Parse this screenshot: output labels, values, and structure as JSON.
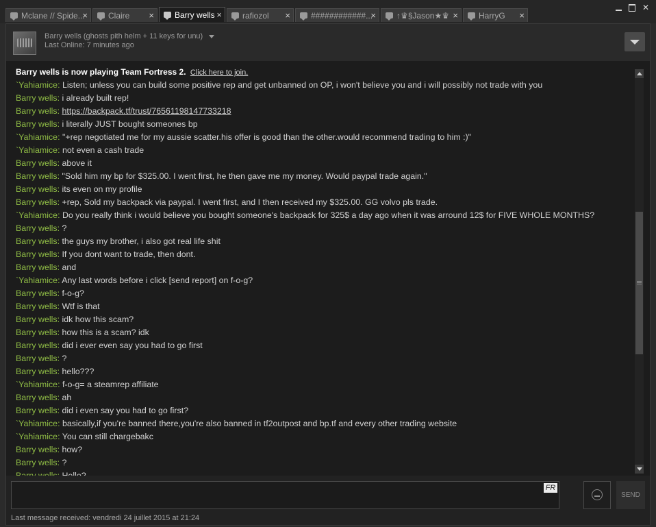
{
  "tabs": [
    {
      "label": "Mclane // Spide...",
      "close": "×",
      "active": false
    },
    {
      "label": "Claire",
      "close": "×",
      "active": false
    },
    {
      "label": "Barry wells",
      "close": "×",
      "active": true
    },
    {
      "label": "rafiozol",
      "close": "×",
      "active": false
    },
    {
      "label": "############...",
      "close": "×",
      "active": false
    },
    {
      "label": "↑♛§Jason★♛",
      "close": "×",
      "active": false
    },
    {
      "label": "HarryG",
      "close": "×",
      "active": false
    }
  ],
  "window": {
    "close_glyph": "✕"
  },
  "header": {
    "friend_name": "Barry wells",
    "friend_nick": "(ghosts pith helm + 11 keys for unu)",
    "last_online": "Last Online: 7 minutes ago"
  },
  "chat": {
    "clipped_top": "· · · ·",
    "system_message": "Barry wells is now playing Team Fortress 2.",
    "join_link": "Click here to join.",
    "messages": [
      {
        "sender": "`Yahiamice",
        "text": "Listen; unless you can build some positive rep and get unbanned on OP, i won't believe you and i will possibly not trade with you"
      },
      {
        "sender": "Barry wells",
        "text": "i already built rep!"
      },
      {
        "sender": "Barry wells",
        "text": "https://backpack.tf/trust/76561198147733218",
        "link": true
      },
      {
        "sender": "Barry wells",
        "text": "i literally JUST bought someones bp"
      },
      {
        "sender": "`Yahiamice",
        "text": "\"+rep negotiated me for my aussie scatter.his offer is good than the other.would recommend trading to him :)\""
      },
      {
        "sender": "`Yahiamice",
        "text": "not even a cash trade"
      },
      {
        "sender": "Barry wells",
        "text": "above it"
      },
      {
        "sender": "Barry wells",
        "text": "\"Sold him my bp for $325.00. I went first, he then gave me my money. Would paypal trade again.\""
      },
      {
        "sender": "Barry wells",
        "text": "its even on my profile"
      },
      {
        "sender": "Barry wells",
        "text": "+rep, Sold my backpack via paypal. I went first, and I then received my $325.00. GG volvo pls trade."
      },
      {
        "sender": "`Yahiamice",
        "text": "Do you really think i would believe you bought someone's backpack for 325$ a day ago when it was arround 12$ for FIVE WHOLE MONTHS?"
      },
      {
        "sender": "Barry wells",
        "text": "?"
      },
      {
        "sender": "Barry wells",
        "text": "the guys my brother, i also got real life shit"
      },
      {
        "sender": "Barry wells",
        "text": "If you dont want to trade, then dont."
      },
      {
        "sender": "Barry wells",
        "text": "and"
      },
      {
        "sender": "`Yahiamice",
        "text": "Any last words before i click [send report] on f-o-g?"
      },
      {
        "sender": "Barry wells",
        "text": "f-o-g?"
      },
      {
        "sender": "Barry wells",
        "text": "Wtf is that"
      },
      {
        "sender": "Barry wells",
        "text": "idk how this scam?"
      },
      {
        "sender": "Barry wells",
        "text": "how this is a scam? idk"
      },
      {
        "sender": "Barry wells",
        "text": "did i ever even say you had to go first"
      },
      {
        "sender": "Barry wells",
        "text": "?"
      },
      {
        "sender": "Barry wells",
        "text": "hello???"
      },
      {
        "sender": "`Yahiamice",
        "text": "f-o-g= a steamrep affiliate"
      },
      {
        "sender": "Barry wells",
        "text": "ah"
      },
      {
        "sender": "Barry wells",
        "text": "did i even say you had to go first?"
      },
      {
        "sender": "`Yahiamice",
        "text": "basically,if you're banned there,you're also banned in tf2outpost and bp.tf and every other trading website"
      },
      {
        "sender": "`Yahiamice",
        "text": "You can still chargebakc"
      },
      {
        "sender": "Barry wells",
        "text": "how?"
      },
      {
        "sender": "Barry wells",
        "text": "?"
      },
      {
        "sender": "Barry wells",
        "text": "Hello?"
      }
    ]
  },
  "input": {
    "lang_badge": "FR",
    "send_label": "SEND"
  },
  "status": {
    "last_message": "Last message received: vendredi 24 juillet 2015 at 21:24"
  },
  "colors": {
    "sender_green": "#8fbc45",
    "background": "#1c1c1c"
  }
}
